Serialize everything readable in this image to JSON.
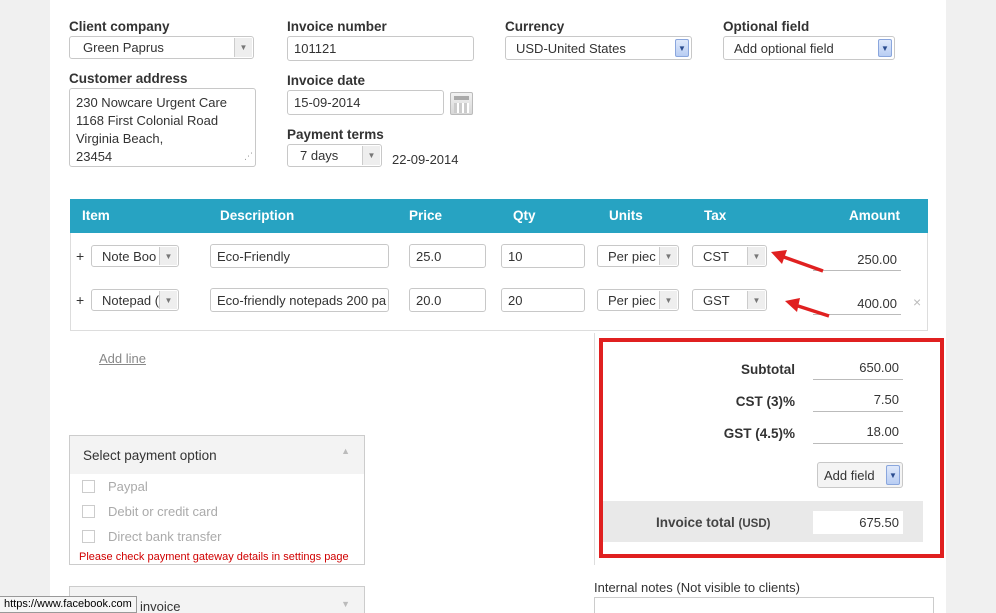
{
  "client": {
    "label": "Client company",
    "value": "Green Paprus"
  },
  "invoice_number": {
    "label": "Invoice number",
    "value": "101121"
  },
  "currency": {
    "label": "Currency",
    "value": "USD-United States"
  },
  "optional_field": {
    "label": "Optional field",
    "value": "Add optional field"
  },
  "address": {
    "label": "Customer address",
    "lines": [
      "230 Nowcare Urgent Care",
      "1168 First Colonial Road",
      "Virginia Beach,",
      "23454"
    ]
  },
  "invoice_date": {
    "label": "Invoice date",
    "value": "15-09-2014"
  },
  "payment_terms": {
    "label": "Payment terms",
    "value": "7 days",
    "due_date": "22-09-2014"
  },
  "table": {
    "headers": {
      "item": "Item",
      "description": "Description",
      "price": "Price",
      "qty": "Qty",
      "units": "Units",
      "tax": "Tax",
      "amount": "Amount"
    },
    "rows": [
      {
        "plus": "+",
        "item": "Note Boo",
        "description": "Eco-Friendly",
        "price": "25.0",
        "qty": "10",
        "units": "Per piec",
        "tax": "CST",
        "amount": "250.00"
      },
      {
        "plus": "+",
        "item": "Notepad (",
        "description": "Eco-friendly notepads 200 pa",
        "price": "20.0",
        "qty": "20",
        "units": "Per piec",
        "tax": "GST",
        "amount": "400.00",
        "remove": "×"
      }
    ]
  },
  "add_line": "Add line",
  "totals": {
    "subtotal_label": "Subtotal",
    "subtotal": "650.00",
    "cst_label": "CST (3)%",
    "cst": "7.50",
    "gst_label": "GST (4.5)%",
    "gst": "18.00",
    "add_field": "Add field",
    "invoice_total_label": "Invoice total",
    "invoice_total_currency": "(USD)",
    "invoice_total": "675.50"
  },
  "payment": {
    "title": "Select payment option",
    "options": [
      "Paypal",
      "Debit or credit card",
      "Direct bank transfer"
    ],
    "warning": "Please check payment gateway details in settings page"
  },
  "bottom_panel_label": "invoice",
  "internal_notes_label": "Internal notes (Not visible to clients)",
  "status_url": "https://www.facebook.com"
}
